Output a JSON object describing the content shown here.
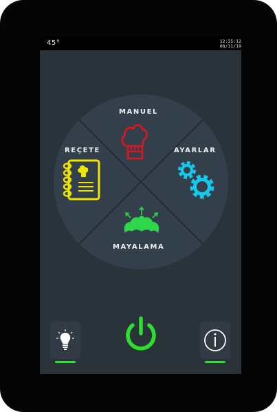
{
  "status": {
    "temperature": "45°",
    "time": "12:35:12",
    "date": "08/11/19"
  },
  "menu": {
    "manual_label": "MANUEL",
    "recipe_label": "REÇETE",
    "settings_label": "AYARLAR",
    "proofing_label": "MAYALAMA"
  },
  "colors": {
    "manual": "#e0141e",
    "recipe": "#f2e600",
    "settings": "#17c8ea",
    "proofing": "#2fd64a",
    "power": "#2de02d",
    "indicator": "#2de02d"
  },
  "icons": {
    "manual": "chef-hat-icon",
    "recipe": "recipe-book-icon",
    "settings": "gears-icon",
    "proofing": "croissant-icon",
    "light": "light-bulb-icon",
    "power": "power-icon",
    "info": "info-icon"
  }
}
